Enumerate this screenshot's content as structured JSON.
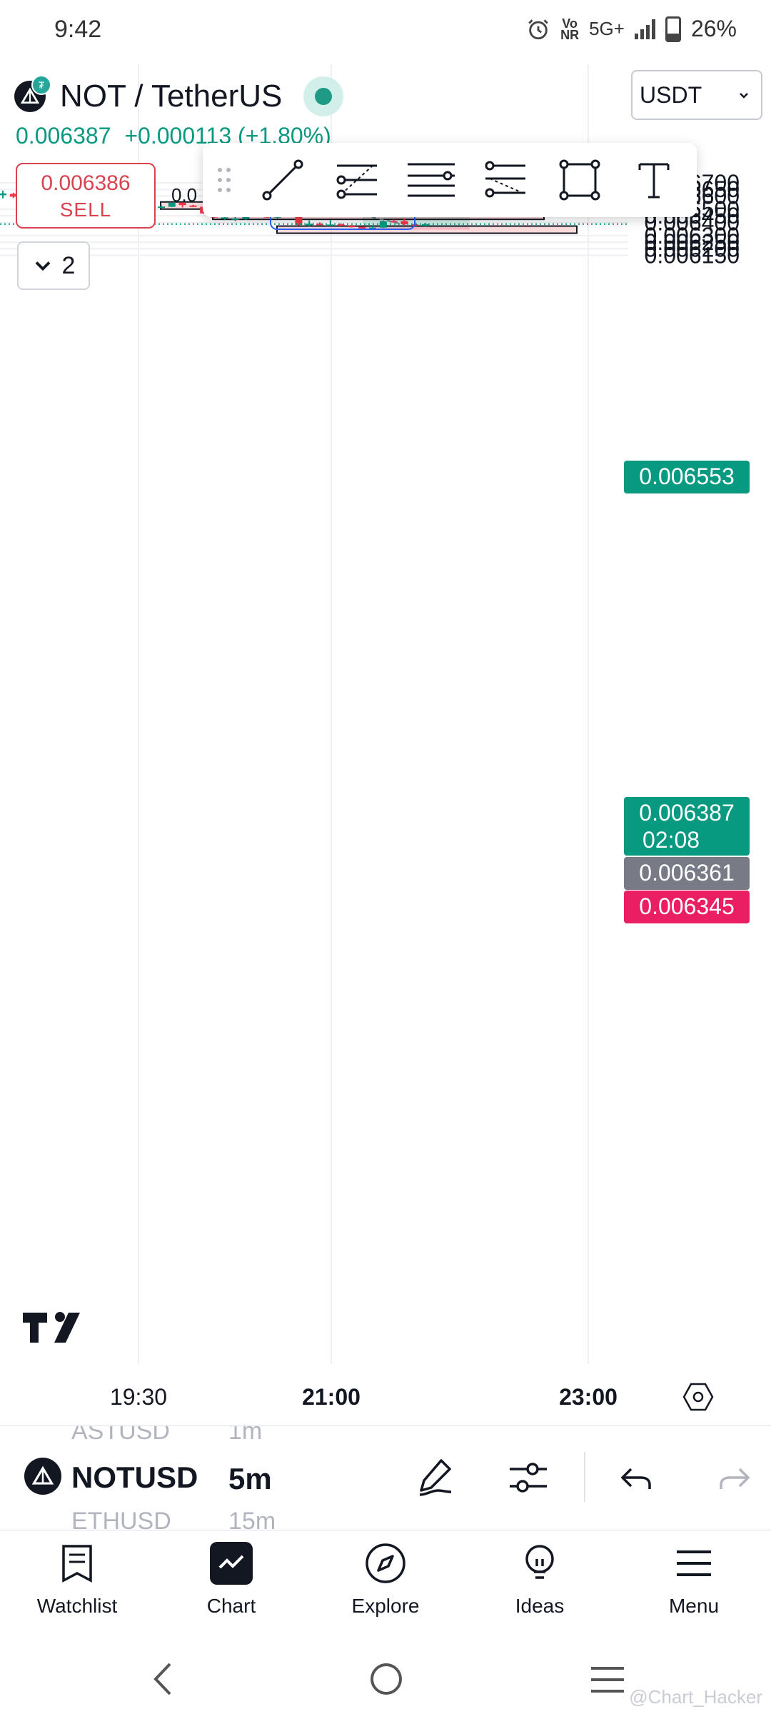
{
  "status_bar": {
    "time": "9:42",
    "carrier_tag_top": "Vo",
    "carrier_tag_bottom": "NR",
    "network": "5G+",
    "battery": "26%"
  },
  "header": {
    "symbol": "NOT / TetherUS",
    "last_price": "0.006387",
    "change": "+0.000113 (+1.80%)",
    "currency": "USDT",
    "sell_price": "0.006386",
    "sell_label": "SELL",
    "buy_peek": "0.0",
    "collapse_count": "2"
  },
  "drawing_tools": [
    "trend-line",
    "fib-retracement",
    "horizontal-lines",
    "pitchfork",
    "rectangle",
    "text"
  ],
  "chart": {
    "price_labels": [
      "0.006700",
      "0.006650",
      "0.006600",
      "0.006500",
      "0.006450",
      "0.006400",
      "0.006300",
      "0.006250",
      "0.006200",
      "0.006150"
    ],
    "price_levels": [
      0.0067,
      0.00665,
      0.0066,
      0.0065,
      0.00645,
      0.0064,
      0.0063,
      0.00625,
      0.0062,
      0.00615
    ],
    "target_tag": "0.006553",
    "current_tag": "0.006387",
    "countdown": "02:08",
    "entry_tag": "0.006361",
    "stop_tag": "0.006345",
    "colors": {
      "up": "#089981",
      "down": "#f23645",
      "target_zone": "#cdebe3",
      "stop_zone": "#fcd4dd",
      "tag_green": "#089981",
      "tag_gray": "#787b86",
      "tag_red": "#e91e63"
    }
  },
  "chart_data": {
    "type": "candlestick",
    "y_axis_range": [
      0.00613,
      0.00673
    ],
    "x_ticks": [
      "19:30",
      "21:00",
      "23:00"
    ],
    "candles": [
      {
        "o": 0.006606,
        "h": 0.006641,
        "l": 0.006582,
        "c": 0.00662
      },
      {
        "o": 0.006616,
        "h": 0.006625,
        "l": 0.006585,
        "c": 0.006595
      },
      {
        "o": 0.00661,
        "h": 0.006618,
        "l": 0.006568,
        "c": 0.006583
      },
      {
        "o": 0.006585,
        "h": 0.00659,
        "l": 0.006562,
        "c": 0.006578
      },
      {
        "o": 0.006578,
        "h": 0.006582,
        "l": 0.006548,
        "c": 0.006555
      },
      {
        "o": 0.006556,
        "h": 0.00658,
        "l": 0.006549,
        "c": 0.006575
      },
      {
        "o": 0.006577,
        "h": 0.006598,
        "l": 0.00655,
        "c": 0.006581
      },
      {
        "o": 0.006585,
        "h": 0.006595,
        "l": 0.00656,
        "c": 0.006565
      },
      {
        "o": 0.006565,
        "h": 0.006575,
        "l": 0.00652,
        "c": 0.006537
      },
      {
        "o": 0.006532,
        "h": 0.006558,
        "l": 0.00651,
        "c": 0.006542
      },
      {
        "o": 0.006538,
        "h": 0.006571,
        "l": 0.00652,
        "c": 0.006562
      },
      {
        "o": 0.006566,
        "h": 0.006573,
        "l": 0.006545,
        "c": 0.006569
      },
      {
        "o": 0.00657,
        "h": 0.006582,
        "l": 0.006545,
        "c": 0.00655
      },
      {
        "o": 0.006546,
        "h": 0.006552,
        "l": 0.006491,
        "c": 0.006503
      },
      {
        "o": 0.00651,
        "h": 0.006535,
        "l": 0.006501,
        "c": 0.006522
      },
      {
        "o": 0.006518,
        "h": 0.006531,
        "l": 0.006505,
        "c": 0.00652
      },
      {
        "o": 0.006518,
        "h": 0.00655,
        "l": 0.006516,
        "c": 0.006548
      },
      {
        "o": 0.006549,
        "h": 0.006551,
        "l": 0.006514,
        "c": 0.006531
      },
      {
        "o": 0.006528,
        "h": 0.006534,
        "l": 0.006518,
        "c": 0.006522
      },
      {
        "o": 0.006518,
        "h": 0.006521,
        "l": 0.006465,
        "c": 0.006468
      },
      {
        "o": 0.006468,
        "h": 0.006473,
        "l": 0.006436,
        "c": 0.006437
      },
      {
        "o": 0.006434,
        "h": 0.00645,
        "l": 0.006418,
        "c": 0.006437
      },
      {
        "o": 0.006425,
        "h": 0.00645,
        "l": 0.00641,
        "c": 0.00643
      },
      {
        "o": 0.006426,
        "h": 0.00646,
        "l": 0.006418,
        "c": 0.006456
      },
      {
        "o": 0.006458,
        "h": 0.006478,
        "l": 0.006446,
        "c": 0.006475
      },
      {
        "o": 0.006476,
        "h": 0.006477,
        "l": 0.006434,
        "c": 0.006437
      },
      {
        "o": 0.006436,
        "h": 0.006472,
        "l": 0.00643,
        "c": 0.006466
      },
      {
        "o": 0.006467,
        "h": 0.006472,
        "l": 0.006449,
        "c": 0.006457
      },
      {
        "o": 0.006454,
        "h": 0.006455,
        "l": 0.006377,
        "c": 0.00638
      },
      {
        "o": 0.006378,
        "h": 0.006415,
        "l": 0.00637,
        "c": 0.00639
      },
      {
        "o": 0.00639,
        "h": 0.0064,
        "l": 0.006378,
        "c": 0.006379
      },
      {
        "o": 0.006379,
        "h": 0.006416,
        "l": 0.006376,
        "c": 0.006384
      },
      {
        "o": 0.006385,
        "h": 0.006393,
        "l": 0.006373,
        "c": 0.006376
      },
      {
        "o": 0.006374,
        "h": 0.00638,
        "l": 0.006362,
        "c": 0.006366
      },
      {
        "o": 0.006366,
        "h": 0.006367,
        "l": 0.006342,
        "c": 0.00635
      },
      {
        "o": 0.006349,
        "h": 0.006371,
        "l": 0.006345,
        "c": 0.006361
      },
      {
        "o": 0.00636,
        "h": 0.006413,
        "l": 0.006357,
        "c": 0.006409
      },
      {
        "o": 0.00641,
        "h": 0.006421,
        "l": 0.006398,
        "c": 0.006409
      },
      {
        "o": 0.00641,
        "h": 0.006433,
        "l": 0.00638,
        "c": 0.006386
      },
      {
        "o": 0.006385,
        "h": 0.006406,
        "l": 0.006373,
        "c": 0.006374
      },
      {
        "o": 0.006374,
        "h": 0.006395,
        "l": 0.006372,
        "c": 0.006387
      }
    ],
    "zones": [
      {
        "type": "supply",
        "top": 0.006555,
        "bottom": 0.006551
      },
      {
        "type": "supply",
        "top": 0.006477,
        "bottom": 0.006472
      },
      {
        "type": "demand",
        "top": 0.006372,
        "bottom": 0.006366
      }
    ],
    "long_position": {
      "entry": 0.006361,
      "target": 0.006553,
      "stop": 0.006345
    }
  },
  "time_axis": {
    "labels": [
      "19:30",
      "21:00",
      "23:00"
    ]
  },
  "bottom_toolbar": {
    "symbol_above": "ASTUSD",
    "interval_above": "1m",
    "symbol": "NOTUSD",
    "interval": "5m",
    "symbol_below": "ETHUSD",
    "interval_below": "15m"
  },
  "nav": {
    "watchlist": "Watchlist",
    "chart": "Chart",
    "explore": "Explore",
    "ideas": "Ideas",
    "menu": "Menu"
  },
  "watermark": "@Chart_Hacker"
}
